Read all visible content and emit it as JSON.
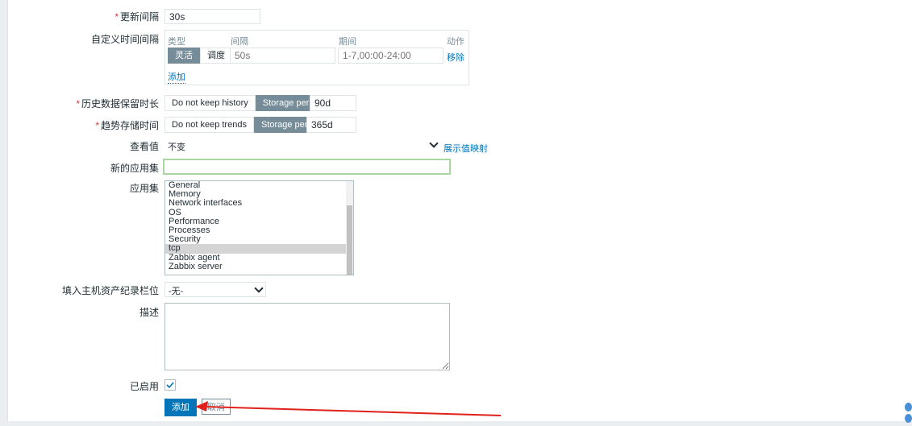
{
  "form": {
    "update_interval": {
      "label": "更新间隔",
      "required": true,
      "value": "30s"
    },
    "custom_intervals": {
      "label": "自定义时间间隔",
      "headers": {
        "type": "类型",
        "interval": "间隔",
        "period": "期间",
        "action": "动作"
      },
      "row": {
        "flexible": "灵活",
        "scheduling": "调度",
        "interval_placeholder": "50s",
        "period_placeholder": "1-7,00:00-24:00",
        "remove": "移除"
      },
      "add": "添加"
    },
    "history": {
      "label": "历史数据保留时长",
      "required": true,
      "opt_no": "Do not keep history",
      "opt_storage": "Storage period",
      "value": "90d"
    },
    "trends": {
      "label": "趋势存储时间",
      "required": true,
      "opt_no": "Do not keep trends",
      "opt_storage": "Storage period",
      "value": "365d"
    },
    "show_value": {
      "label": "查看值",
      "value": "不变",
      "link": "展示值映射"
    },
    "new_application": {
      "label": "新的应用集",
      "value": ""
    },
    "applications": {
      "label": "应用集",
      "items": [
        "General",
        "Memory",
        "Network interfaces",
        "OS",
        "Performance",
        "Processes",
        "Security",
        "tcp",
        "Zabbix agent",
        "Zabbix server"
      ],
      "selected": "tcp"
    },
    "inventory": {
      "label": "填入主机资产纪录栏位",
      "value": "-无-"
    },
    "description": {
      "label": "描述",
      "value": ""
    },
    "enabled": {
      "label": "已启用",
      "checked": true
    },
    "buttons": {
      "add": "添加",
      "cancel": "取消"
    }
  },
  "colors": {
    "accent": "#0275b8",
    "segment_active": "#768d99",
    "required": "#e33734",
    "annotation_arrow": "#e0201b"
  }
}
